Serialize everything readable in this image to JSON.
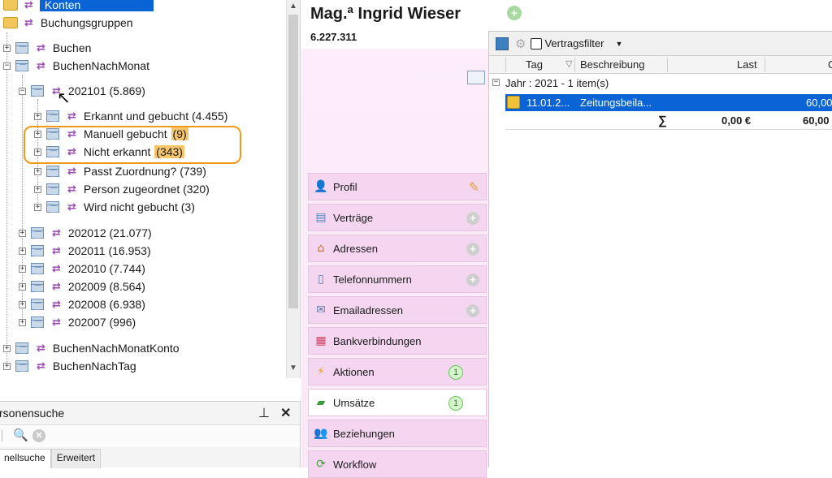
{
  "tree": {
    "items": [
      {
        "label": "Konten"
      },
      {
        "label": "Buchungsgruppen"
      },
      {
        "label": "Buchen"
      },
      {
        "label": "BuchenNachMonat"
      },
      {
        "label": "202101 (5.869)"
      },
      {
        "label": "Erkannt und gebucht (4.455)"
      },
      {
        "label": "Manuell gebucht ",
        "count": "(9)"
      },
      {
        "label": "Nicht erkannt ",
        "count": "(343)"
      },
      {
        "label": "Passt Zuordnung? (739)"
      },
      {
        "label": "Person zugeordnet (320)"
      },
      {
        "label": "Wird nicht gebucht (3)"
      },
      {
        "label": "202012 (21.077)"
      },
      {
        "label": "202011 (16.953)"
      },
      {
        "label": "202010 (7.744)"
      },
      {
        "label": "202009 (8.564)"
      },
      {
        "label": "202008 (6.938)"
      },
      {
        "label": "202007 (996)"
      },
      {
        "label": "BuchenNachMonatKonto"
      },
      {
        "label": "BuchenNachTag"
      }
    ]
  },
  "search_panel": {
    "title": "rsonensuche",
    "pin": "⊥",
    "close": "✕",
    "tabs": [
      "nellsuche",
      "Erweitert"
    ]
  },
  "person": {
    "name": "Mag.ª Ingrid Wieser",
    "number": "6.227.311"
  },
  "side_menu": [
    {
      "label": "Profil",
      "icon": "person-icon"
    },
    {
      "label": "Verträge",
      "icon": "contract-icon"
    },
    {
      "label": "Adressen",
      "icon": "house-icon"
    },
    {
      "label": "Telefonnummern",
      "icon": "phone-icon"
    },
    {
      "label": "Emailadressen",
      "icon": "mail-icon"
    },
    {
      "label": "Bankverbindungen",
      "icon": "bank-icon"
    },
    {
      "label": "Aktionen",
      "icon": "lightning-icon",
      "badge": "1"
    },
    {
      "label": "Umsätze",
      "icon": "money-icon",
      "badge": "1"
    },
    {
      "label": "Beziehungen",
      "icon": "people-icon"
    },
    {
      "label": "Workflow",
      "icon": "workflow-icon"
    }
  ],
  "grid": {
    "filter_label": "Vertragsfilter",
    "columns": {
      "tag": "Tag",
      "beschreibung": "Beschreibung",
      "last": "Last",
      "g": "G"
    },
    "group_label": "Jahr : 2021 - 1 item(s)",
    "row": {
      "tag": "11.01.2...",
      "beschreibung": "Zeitungsbeila...",
      "last": "",
      "g": "60,00"
    },
    "sum": {
      "symbol": "∑",
      "last": "0,00 €",
      "g": "60,00"
    }
  },
  "colors": {
    "selection": "#0a64d6",
    "highlight": "#f8c66a",
    "annotation": "#f09a1a",
    "menu_bg": "#f5d6f1"
  }
}
